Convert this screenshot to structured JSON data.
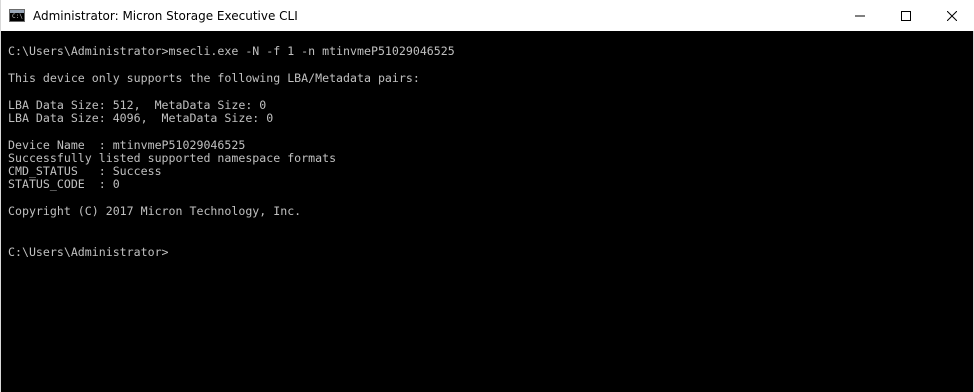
{
  "window": {
    "title": "Administrator: Micron Storage Executive CLI",
    "icon": "console-app-icon"
  },
  "controls": {
    "minimize_icon": "minimize-icon",
    "maximize_icon": "maximize-icon",
    "close_icon": "close-icon"
  },
  "console": {
    "background": "#000000",
    "foreground": "#c0c0c0",
    "lines": [
      "",
      "C:\\Users\\Administrator>msecli.exe -N -f 1 -n mtinvmeP51029046525",
      "",
      "This device only supports the following LBA/Metadata pairs:",
      "",
      "LBA Data Size: 512,  MetaData Size: 0",
      "LBA Data Size: 4096,  MetaData Size: 0",
      "",
      "Device Name  : mtinvmeP51029046525",
      "Successfully listed supported namespace formats",
      "CMD_STATUS   : Success",
      "STATUS_CODE  : 0",
      "",
      "Copyright (C) 2017 Micron Technology, Inc.",
      "",
      "",
      "C:\\Users\\Administrator>"
    ]
  }
}
